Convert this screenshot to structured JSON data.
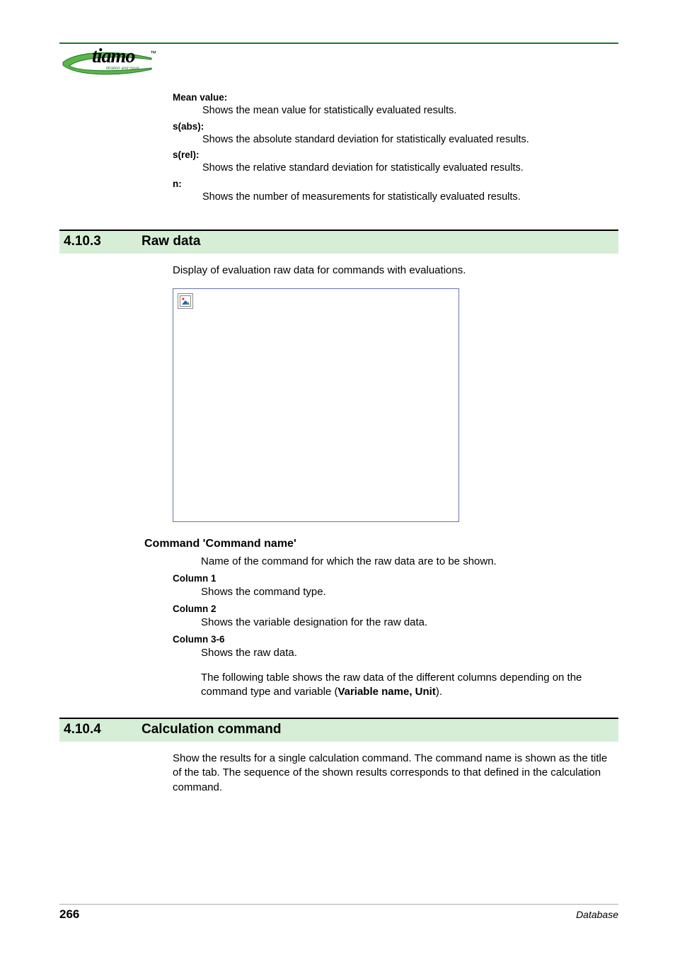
{
  "logo": {
    "name": "tiamo",
    "tm": "™",
    "subtitle": "titration and more"
  },
  "top_definitions": [
    {
      "term": "Mean value:",
      "desc": "Shows the mean value for statistically evaluated results."
    },
    {
      "term": "s(abs):",
      "desc": "Shows the absolute standard deviation for statistically evaluated results."
    },
    {
      "term": "s(rel):",
      "desc": "Shows the relative standard deviation for statistically evaluated results."
    },
    {
      "term": "n:",
      "desc": "Shows the number of measurements for statistically evaluated results."
    }
  ],
  "sections": {
    "rawdata": {
      "number": "4.10.3",
      "title": "Raw data",
      "intro": "Display of evaluation raw data for commands with evaluations.",
      "subhead": "Command 'Command name'",
      "subdesc": "Name of the command for which the raw data are to be shown.",
      "columns": [
        {
          "term": "Column 1",
          "desc": "Shows the command type."
        },
        {
          "term": "Column 2",
          "desc": "Shows the variable designation for the raw data."
        },
        {
          "term": "Column 3-6",
          "desc": "Shows the raw data."
        }
      ],
      "following_prefix": "The following table shows the raw data of the different columns depending on the command type and variable (",
      "following_var": "Variable name, Unit",
      "following_suffix": ")."
    },
    "calc": {
      "number": "4.10.4",
      "title": "Calculation command",
      "body": "Show the results for a single calculation command. The command name is shown as the title of the tab. The sequence of the shown results corresponds to that defined in the calculation command."
    }
  },
  "footer": {
    "page": "266",
    "label": "Database"
  }
}
